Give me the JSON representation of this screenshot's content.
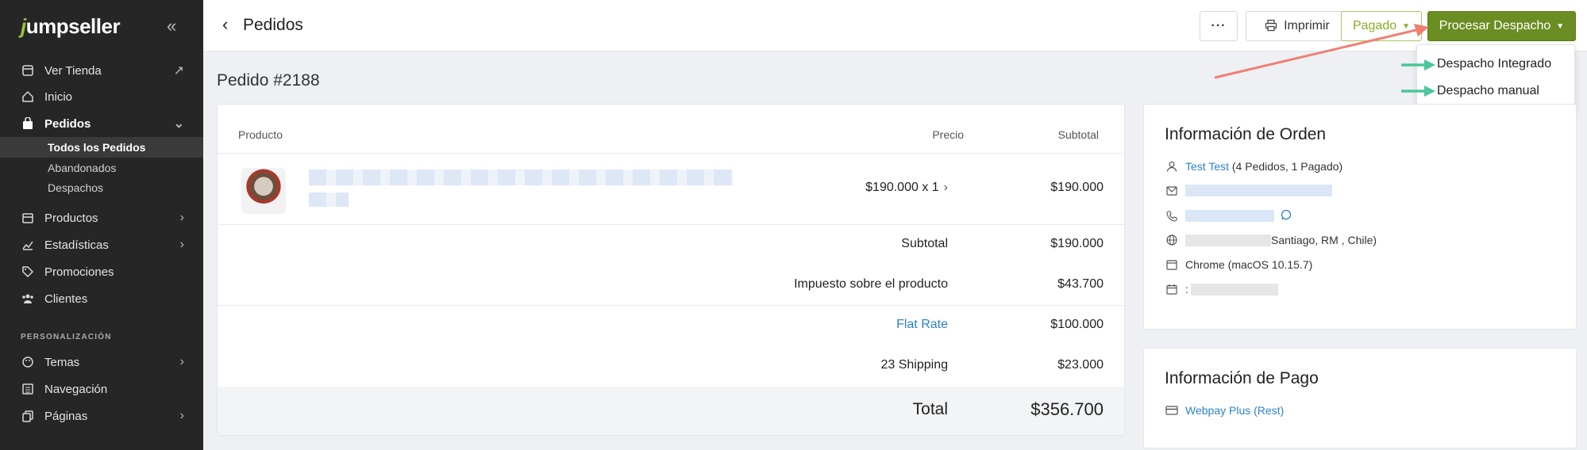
{
  "sidebar": {
    "brand_prefix": "j",
    "brand_rest": "umpseller",
    "collapse_icon": "«",
    "items": [
      {
        "label": "Ver Tienda",
        "icon": "store-icon"
      },
      {
        "label": "Inicio",
        "icon": "home-icon"
      },
      {
        "label": "Pedidos",
        "icon": "bag-icon"
      },
      {
        "label": "Productos",
        "icon": "box-icon"
      },
      {
        "label": "Estadísticas",
        "icon": "chart-icon"
      },
      {
        "label": "Promociones",
        "icon": "tag-icon"
      },
      {
        "label": "Clientes",
        "icon": "users-icon"
      },
      {
        "label": "Temas",
        "icon": "palette-icon"
      },
      {
        "label": "Navegación",
        "icon": "list-icon"
      },
      {
        "label": "Páginas",
        "icon": "pages-icon"
      }
    ],
    "sub_items": [
      "Todos los Pedidos",
      "Abandonados",
      "Despachos"
    ],
    "section_label": "PERSONALIZACIÓN"
  },
  "topbar": {
    "title": "Pedidos",
    "more_label": "···",
    "print_label": "Imprimir",
    "paid_label": "Pagado",
    "dispatch_label": "Procesar Despacho"
  },
  "dropdown": {
    "items": [
      "Despacho Integrado",
      "Despacho manual"
    ]
  },
  "order": {
    "title": "Pedido #2188",
    "headers": {
      "product": "Producto",
      "price": "Precio",
      "subtotal": "Subtotal"
    },
    "line": {
      "price_qty": "$190.000 x 1",
      "subtotal": "$190.000"
    },
    "summary": [
      {
        "label": "Subtotal",
        "value": "$190.000"
      },
      {
        "label": "Impuesto sobre el producto",
        "value": "$43.700"
      },
      {
        "label": "Flat Rate",
        "value": "$100.000"
      },
      {
        "label": "23 Shipping",
        "value": "$23.000"
      }
    ],
    "total": {
      "label": "Total",
      "value": "$356.700"
    }
  },
  "order_info": {
    "title": "Información de Orden",
    "customer_name": "Test Test",
    "customer_stats": "(4 Pedidos, 1 Pagado)",
    "location": "Santiago, RM , Chile)",
    "browser": "Chrome (macOS 10.15.7)",
    "date_prefix": ":"
  },
  "payment_info": {
    "title": "Información de Pago",
    "method": "Webpay Plus (Rest)"
  },
  "colors": {
    "accent_green": "#6b8e23",
    "link_blue": "#2c82c9",
    "annotation_red": "#f07f72",
    "annotation_teal": "#4cc69a"
  }
}
